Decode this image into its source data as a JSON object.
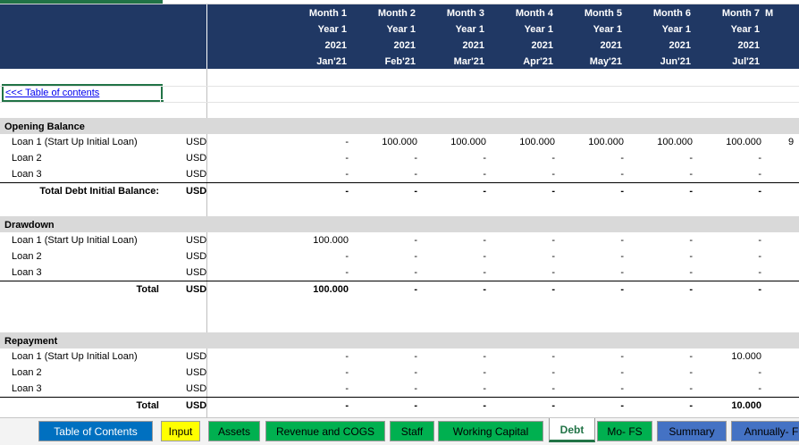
{
  "months": [
    {
      "month": "Month 1",
      "year": "Year 1",
      "yr": "2021",
      "label": "Jan'21"
    },
    {
      "month": "Month 2",
      "year": "Year 1",
      "yr": "2021",
      "label": "Feb'21"
    },
    {
      "month": "Month 3",
      "year": "Year 1",
      "yr": "2021",
      "label": "Mar'21"
    },
    {
      "month": "Month 4",
      "year": "Year 1",
      "yr": "2021",
      "label": "Apr'21"
    },
    {
      "month": "Month 5",
      "year": "Year 1",
      "yr": "2021",
      "label": "May'21"
    },
    {
      "month": "Month 6",
      "year": "Year 1",
      "yr": "2021",
      "label": "Jun'21"
    },
    {
      "month": "Month 7",
      "year": "Year 1",
      "yr": "2021",
      "label": "Jul'21"
    },
    {
      "month": "M",
      "year": "",
      "yr": "",
      "label": ""
    }
  ],
  "toc_link": "<<< Table of contents",
  "sections": {
    "opening": {
      "title": "Opening Balance",
      "rows": [
        {
          "label": "Loan 1 (Start Up Initial Loan)",
          "unit": "USD",
          "values": [
            "-",
            "100.000",
            "100.000",
            "100.000",
            "100.000",
            "100.000",
            "100.000",
            "9"
          ]
        },
        {
          "label": "Loan 2",
          "unit": "USD",
          "values": [
            "-",
            "-",
            "-",
            "-",
            "-",
            "-",
            "-",
            ""
          ]
        },
        {
          "label": "Loan 3",
          "unit": "USD",
          "values": [
            "-",
            "-",
            "-",
            "-",
            "-",
            "-",
            "-",
            ""
          ]
        }
      ],
      "total": {
        "label": "Total Debt Initial Balance:",
        "unit": "USD",
        "values": [
          "-",
          "-",
          "-",
          "-",
          "-",
          "-",
          "-",
          ""
        ]
      }
    },
    "drawdown": {
      "title": "Drawdown",
      "rows": [
        {
          "label": "Loan 1 (Start Up Initial Loan)",
          "unit": "USD",
          "values": [
            "100.000",
            "-",
            "-",
            "-",
            "-",
            "-",
            "-",
            ""
          ]
        },
        {
          "label": "Loan 2",
          "unit": "USD",
          "values": [
            "-",
            "-",
            "-",
            "-",
            "-",
            "-",
            "-",
            ""
          ]
        },
        {
          "label": "Loan 3",
          "unit": "USD",
          "values": [
            "-",
            "-",
            "-",
            "-",
            "-",
            "-",
            "-",
            ""
          ]
        }
      ],
      "total": {
        "label": "Total",
        "unit": "USD",
        "values": [
          "100.000",
          "-",
          "-",
          "-",
          "-",
          "-",
          "-",
          ""
        ]
      }
    },
    "repayment": {
      "title": "Repayment",
      "rows": [
        {
          "label": "Loan 1 (Start Up Initial Loan)",
          "unit": "USD",
          "values": [
            "-",
            "-",
            "-",
            "-",
            "-",
            "-",
            "10.000",
            ""
          ]
        },
        {
          "label": "Loan 2",
          "unit": "USD",
          "values": [
            "-",
            "-",
            "-",
            "-",
            "-",
            "-",
            "-",
            ""
          ]
        },
        {
          "label": "Loan 3",
          "unit": "USD",
          "values": [
            "-",
            "-",
            "-",
            "-",
            "-",
            "-",
            "-",
            ""
          ]
        }
      ],
      "total": {
        "label": "Total",
        "unit": "USD",
        "values": [
          "-",
          "-",
          "-",
          "-",
          "-",
          "-",
          "10.000",
          ""
        ]
      }
    }
  },
  "tabs": [
    {
      "label": "Table of Contents",
      "bg": "#0070c0",
      "fg": "#ffffff"
    },
    {
      "label": "Input",
      "bg": "#ffff00",
      "fg": "#000000"
    },
    {
      "label": "Assets",
      "bg": "#00b050",
      "fg": "#000000"
    },
    {
      "label": "Revenue and COGS",
      "bg": "#00b050",
      "fg": "#000000"
    },
    {
      "label": "Staff",
      "bg": "#00b050",
      "fg": "#000000"
    },
    {
      "label": "Working Capital",
      "bg": "#00b050",
      "fg": "#000000"
    },
    {
      "label": "Debt",
      "bg": "#ffffff",
      "fg": "#217346",
      "active": true
    },
    {
      "label": "Mo- FS",
      "bg": "#00b050",
      "fg": "#000000"
    },
    {
      "label": "Summary",
      "bg": "#4472c4",
      "fg": "#000000"
    },
    {
      "label": "Annually- F",
      "bg": "#4472c4",
      "fg": "#000000"
    }
  ]
}
